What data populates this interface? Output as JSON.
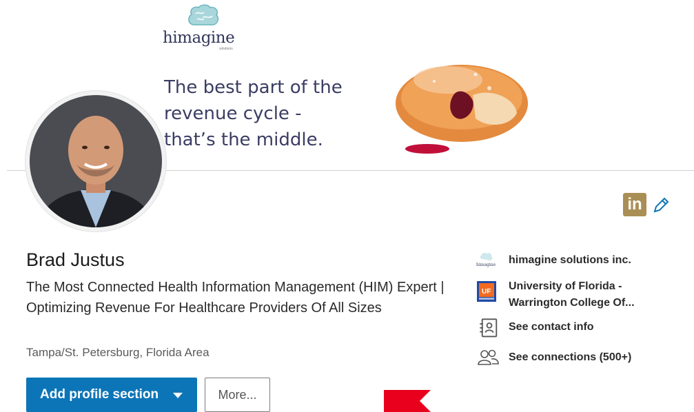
{
  "banner": {
    "brand_name": "himagine",
    "brand_sub": "solutions",
    "tagline": "The best part of the\nrevenue cycle -\nthat’s the middle."
  },
  "profile": {
    "name": "Brad Justus",
    "headline": "The Most Connected Health Information Management (HIM) Expert | Optimizing Revenue For Healthcare Providers Of All Sizes",
    "location": "Tampa/St. Petersburg, Florida Area"
  },
  "actions": {
    "add_section_label": "Add profile section",
    "more_label": "More..."
  },
  "badge": {
    "text": "in"
  },
  "sidebar": {
    "company": "himagine solutions inc.",
    "company_logo_text": "himagine",
    "education_line1": "University of Florida -",
    "education_line2": "Warrington College Of...",
    "education_logo_text": "UF",
    "contact": "See contact info",
    "connections": "See connections (500+)"
  },
  "colors": {
    "primary_button": "#0c75b8",
    "linkedin_badge": "#a98f55",
    "tagline": "#3a3d63",
    "accent_red": "#e8001c"
  },
  "icons": [
    "brain-logo-icon",
    "linkedin-icon",
    "pencil-icon",
    "contact-card-icon",
    "people-icon",
    "chevron-down-icon"
  ]
}
